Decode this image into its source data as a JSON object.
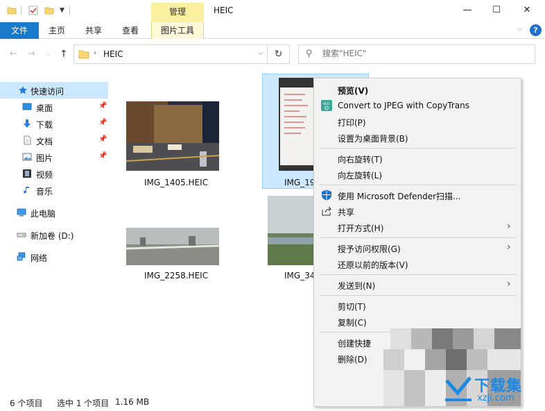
{
  "titlebar": {
    "manage_tab": "管理",
    "title": "HEIC",
    "minimize": "—",
    "maximize": "☐",
    "close": "✕"
  },
  "ribbon": {
    "file": "文件",
    "home": "主页",
    "share": "共享",
    "view": "查看",
    "picture_tools": "图片工具",
    "help": "?"
  },
  "nav": {
    "address": "HEIC",
    "search_placeholder": "搜索\"HEIC\""
  },
  "sidebar": {
    "items": [
      {
        "label": "快速访问",
        "icon": "star-icon"
      },
      {
        "label": "桌面",
        "icon": "desktop-icon",
        "pinned": true
      },
      {
        "label": "下载",
        "icon": "download-icon",
        "pinned": true
      },
      {
        "label": "文档",
        "icon": "document-icon",
        "pinned": true
      },
      {
        "label": "图片",
        "icon": "picture-icon",
        "pinned": true
      },
      {
        "label": "视频",
        "icon": "video-icon"
      },
      {
        "label": "音乐",
        "icon": "music-icon"
      },
      {
        "label": "此电脑",
        "icon": "computer-icon"
      },
      {
        "label": "新加卷 (D:)",
        "icon": "drive-icon"
      },
      {
        "label": "网络",
        "icon": "network-icon"
      }
    ]
  },
  "files": [
    {
      "name": "IMG_1405.HEIC"
    },
    {
      "name": "IMG_19"
    },
    {
      "name": "IMG_2258.HEIC"
    },
    {
      "name": "IMG_34"
    }
  ],
  "context_menu": {
    "items": [
      {
        "label": "预览(V)",
        "bold": true
      },
      {
        "label": "Convert to JPEG with CopyTrans",
        "icon": "heic-convert-icon"
      },
      {
        "label": "打印(P)"
      },
      {
        "label": "设置为桌面背景(B)"
      },
      {
        "label": "向右旋转(T)"
      },
      {
        "label": "向左旋转(L)"
      },
      {
        "label": "使用 Microsoft Defender扫描...",
        "icon": "defender-shield-icon"
      },
      {
        "label": "共享",
        "icon": "share-icon"
      },
      {
        "label": "打开方式(H)",
        "submenu": true
      },
      {
        "label": "授予访问权限(G)",
        "submenu": true
      },
      {
        "label": "还原以前的版本(V)"
      },
      {
        "label": "发送到(N)",
        "submenu": true
      },
      {
        "label": "剪切(T)"
      },
      {
        "label": "复制(C)"
      },
      {
        "label": "创建快捷"
      },
      {
        "label": "删除(D)"
      }
    ]
  },
  "status": {
    "count": "6 个项目",
    "selected": "选中 1 个项目",
    "size": "1.16 MB"
  },
  "watermark": {
    "text": "下载集",
    "sub": "xzji.com"
  }
}
